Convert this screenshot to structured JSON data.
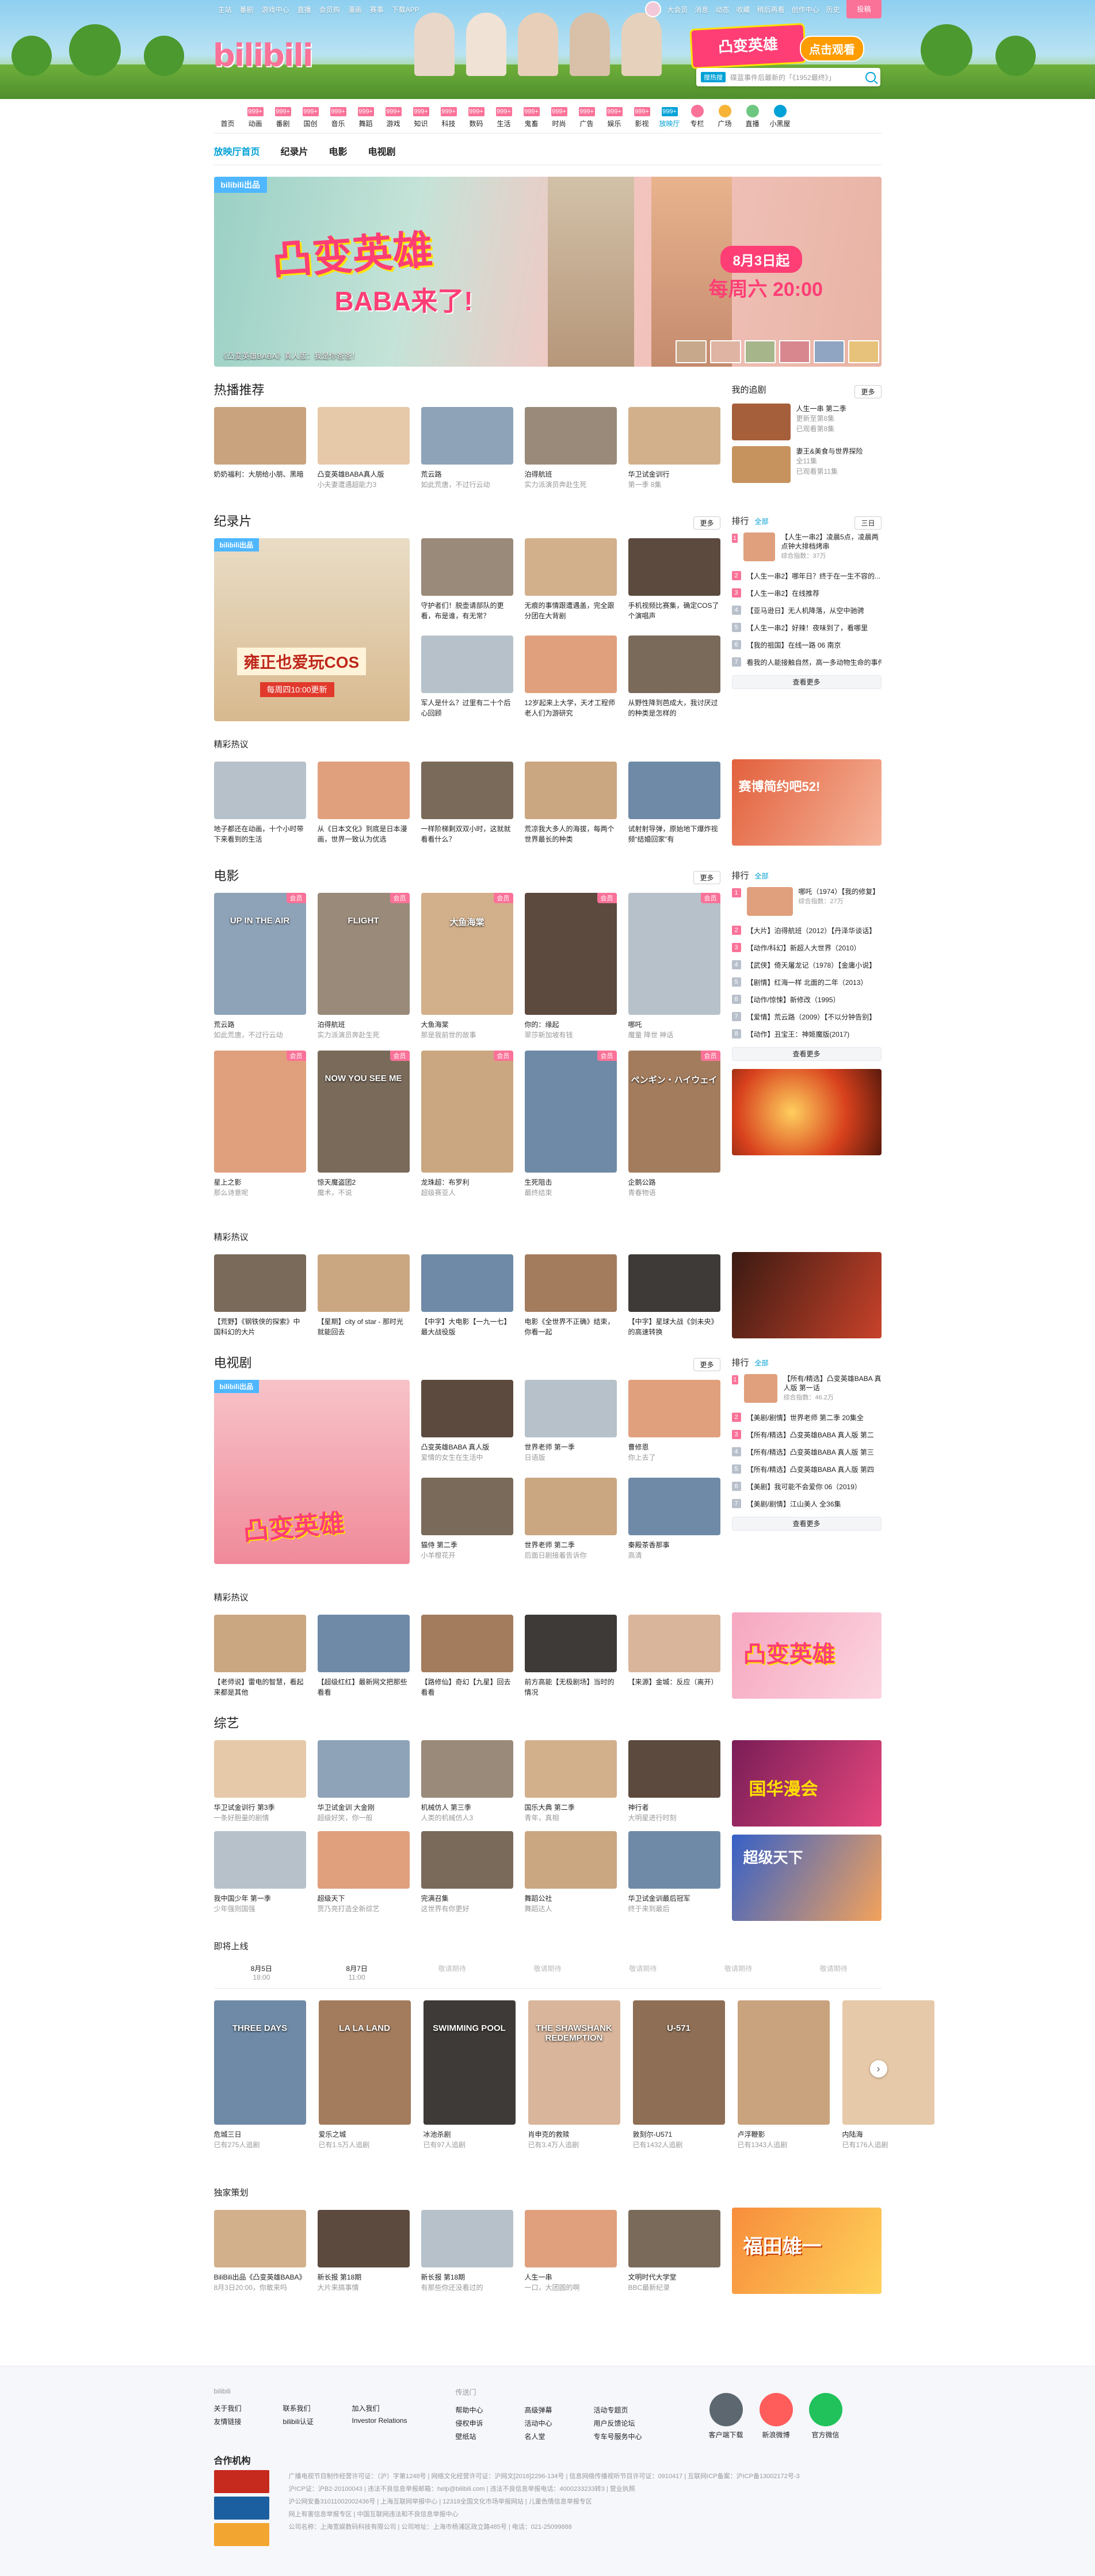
{
  "top_nav": [
    "主站",
    "番剧",
    "游戏中心",
    "直播",
    "会员购",
    "漫画",
    "赛事",
    "下载APP"
  ],
  "top_right": [
    "大会员",
    "消息",
    "动态",
    "收藏",
    "稍后再看",
    "创作中心",
    "历史"
  ],
  "upload": "投稿",
  "search": {
    "placeholder": "碟蓝事件后最新的「《1952最终》」",
    "hot": "搜热搜"
  },
  "promo": {
    "title": "凸变英雄",
    "button": "点击观看"
  },
  "logo": "bilibili",
  "channels": [
    {
      "label": "首页",
      "num": ""
    },
    {
      "label": "动画",
      "num": "999+"
    },
    {
      "label": "番剧",
      "num": "999+"
    },
    {
      "label": "国创",
      "num": "999+"
    },
    {
      "label": "音乐",
      "num": "999+"
    },
    {
      "label": "舞蹈",
      "num": "999+"
    },
    {
      "label": "游戏",
      "num": "999+"
    },
    {
      "label": "知识",
      "num": "999+"
    },
    {
      "label": "科技",
      "num": "999+"
    },
    {
      "label": "数码",
      "num": "999+"
    },
    {
      "label": "生活",
      "num": "999+"
    },
    {
      "label": "鬼畜",
      "num": "999+"
    },
    {
      "label": "时尚",
      "num": "999+"
    },
    {
      "label": "广告",
      "num": "999+"
    },
    {
      "label": "娱乐",
      "num": "999+"
    },
    {
      "label": "影视",
      "num": "999+"
    },
    {
      "label": "放映厅",
      "num": "999+",
      "active": true
    },
    {
      "label": "专栏",
      "num": "",
      "icon": true
    },
    {
      "label": "广场",
      "num": "",
      "icon": true
    },
    {
      "label": "直播",
      "num": "",
      "icon": true
    },
    {
      "label": "小黑屋",
      "num": "",
      "icon": true
    }
  ],
  "subtabs": [
    "放映厅首页",
    "纪录片",
    "电影",
    "电视剧"
  ],
  "hero": {
    "badge": "bilibili出品",
    "title": "凸变英雄",
    "subtitle": "BABA来了!",
    "time": "8月3日起",
    "clock": "每周六 20:00",
    "caption": "《凸变英雄BABA》真人版：我是你爸爸！"
  },
  "hot": {
    "title": "热播推荐",
    "items": [
      {
        "t": "奶奶福利：大朋给小朋、黑暗就是这么简单",
        "s": ""
      },
      {
        "t": "凸变英雄BABA真人版",
        "s": "小夫妻遭遇超能力3"
      },
      {
        "t": "荒云路",
        "s": "如此荒唐，不过行云动"
      },
      {
        "t": "泊得航班",
        "s": "实力派演员奔赴生死"
      },
      {
        "t": "华卫试金训行",
        "s": "第一季 8集"
      }
    ],
    "follow_title": "我的追剧",
    "follow_more": "更多",
    "follow": [
      {
        "t": "人生一串 第二季",
        "s": "更新至第8集",
        "s2": "已观看第8集"
      },
      {
        "t": "妻王&美食与世界探险",
        "s": "全11集",
        "s2": "已观看第11集"
      }
    ]
  },
  "docs": {
    "title": "纪录片",
    "more": "更多",
    "big": {
      "badge": "bilibili出品",
      "t": "雍正也爱玩COS",
      "s": "每周四10:00更新"
    },
    "items": [
      {
        "t": "守护者们！脱壶请部队的更看，布是谁，有无常？",
        "s": ""
      },
      {
        "t": "无痕的事情跟遭遇盖，完全跟分团在大背剧",
        "s": ""
      },
      {
        "t": "手机视频比赛集，确定COS了个演唱声",
        "s": ""
      },
      {
        "t": "军人是什么？过里有二十个后心回顾",
        "s": ""
      },
      {
        "t": "12岁起来上大学，天才工程师老人们为游研究",
        "s": ""
      },
      {
        "t": "从野性降到芭成大，我讨厌过的种类是怎样的",
        "s": ""
      }
    ],
    "rank_title": "排行",
    "rank_tab": "全部",
    "rank_range": "三日",
    "rank": [
      {
        "t": "【人生一串2】凌晨5点，凌晨两点钟大排档烤串",
        "s": "综合指数：37万"
      },
      {
        "t": "【人生一串2】哪年日？终于在一生不容的..."
      },
      {
        "t": "【人生一串2】在线推荐"
      },
      {
        "t": "【亚马逊日】无人机降落，从空中驰骋"
      },
      {
        "t": "【人生一串2】好辣！夜味到了，看哪里"
      },
      {
        "t": "【我的祖国】在线一路 06 南京"
      },
      {
        "t": "看我的人能接触自然，高一多动物生命的事件"
      }
    ],
    "see_more": "查看更多"
  },
  "jingcai1": {
    "title": "精彩热议",
    "items": [
      {
        "t": "地子都还在动画，十个小时带下来看到的生活"
      },
      {
        "t": "从《日本文化》到底是日本漫画，世界一致认为优选"
      },
      {
        "t": "一样阶梯剩双双小时，这就就看看什么？"
      },
      {
        "t": "荒凉我大多人的海拔，每两个世界最长的种类"
      },
      {
        "t": "试射射导弹，原始地下爆炸视频“结婚回家”有"
      }
    ],
    "poster": "赛博简约吧52!"
  },
  "movies": {
    "title": "电影",
    "more": "更多",
    "items": [
      {
        "t": "荒云路",
        "s": "如此荒唐，不过行云动"
      },
      {
        "t": "泊得航班",
        "s": "实力派演员奔赴生死"
      },
      {
        "t": "大鱼海棠",
        "s": "那是我前世的故事"
      },
      {
        "t": "你的：缘起",
        "s": "翠莎新加坡有钱"
      },
      {
        "t": "哪吒",
        "s": "魔童 降世 神话"
      },
      {
        "t": "星上之影",
        "s": "那么诗意呢"
      },
      {
        "t": "惊天魔盗团2",
        "s": "魔术，不说"
      },
      {
        "t": "龙珠超：布罗利",
        "s": "超级赛亚人"
      },
      {
        "t": "生死阻击",
        "s": "最终结束"
      },
      {
        "t": "企鹅公路",
        "s": "青春物语"
      }
    ],
    "labels": [
      "UP IN THE AIR",
      "FLIGHT",
      "大鱼海棠",
      "",
      "",
      "",
      "NOW YOU SEE ME",
      "",
      "",
      "ペンギン・ハイウェイ"
    ],
    "rank_title": "排行",
    "rank_tab": "全部",
    "rank": [
      {
        "t": "哪吒（1974）【我的修复】",
        "s": "综合指数：27万"
      },
      {
        "t": "【大片】泊得航班（2012）【丹泽华谈话】"
      },
      {
        "t": "【动作/科幻】新超人大世界（2010）"
      },
      {
        "t": "【武侠】倚天屠龙记（1978）【金庸小说】"
      },
      {
        "t": "【剧情】红海一样 北面的二年（2013）"
      },
      {
        "t": "【动作/惊悚】新修改（1995）"
      },
      {
        "t": "【爱情】荒云路（2009）【不以分钟告别】"
      },
      {
        "t": "【动作】丑宝王：神姬魔版(2017)"
      }
    ],
    "see_more": "查看更多"
  },
  "jingcai2": {
    "title": "精彩热议",
    "items": [
      {
        "t": "【荒野】《钢铁侠的探索》中国科幻的大片",
        "s": ""
      },
      {
        "t": "【星期】city of star - 那时光就能回去",
        "s": ""
      },
      {
        "t": "【中字】大电影【一九一七】最大战役版",
        "s": ""
      },
      {
        "t": "电影《全世界不正确》结束，你看一起",
        "s": ""
      },
      {
        "t": "【中字】星球大战《剑未央》的高速转换",
        "s": ""
      }
    ]
  },
  "tv": {
    "title": "电视剧",
    "more": "更多",
    "big": {
      "badge": "bilibili出品",
      "t": "凸变英雄"
    },
    "items": [
      {
        "t": "凸变英雄BABA 真人版",
        "s": "爱情的女生在生活中"
      },
      {
        "t": "世界老师 第一季",
        "s": "日语版"
      },
      {
        "t": "曹修恩",
        "s": "你上去了"
      },
      {
        "t": "猫侍 第二季",
        "s": "小羊橙花开"
      },
      {
        "t": "世界老师 第二季",
        "s": "后面日剧接着告诉你"
      },
      {
        "t": "秦殿茶香那事",
        "s": "高清"
      }
    ],
    "rank_title": "排行",
    "rank_tab": "全部",
    "rank": [
      {
        "t": "【所有/精选】凸变英雄BABA 真人版 第一话",
        "s": "综合指数：46.2万"
      },
      {
        "t": "【美剧/剧情】世界老师 第二季 20集全"
      },
      {
        "t": "【所有/精选】凸变英雄BABA 真人版 第二"
      },
      {
        "t": "【所有/精选】凸变英雄BABA 真人版 第三"
      },
      {
        "t": "【所有/精选】凸变英雄BABA 真人版 第四"
      },
      {
        "t": "【美剧】我可能不会爱你 06（2019）"
      },
      {
        "t": "【美剧/剧情】江山美人 全36集"
      }
    ],
    "see_more": "查看更多"
  },
  "jingcai3": {
    "title": "精彩热议",
    "items": [
      {
        "t": "【老师说】雷电的智慧，看起来都是其他",
        "s": ""
      },
      {
        "t": "【超级红红】最新网文把那些看看",
        "s": ""
      },
      {
        "t": "【路修仙】奇幻【九星】回去看看",
        "s": ""
      },
      {
        "t": "前方高能【无极剧场】当时的情况",
        "s": ""
      },
      {
        "t": "【来源】金城：反应（离开）",
        "s": ""
      }
    ]
  },
  "variety": {
    "title": "综艺",
    "items": [
      {
        "t": "华卫试金训行 第3季",
        "s": "一条好胆量的剧情"
      },
      {
        "t": "华卫试金训 大金刚",
        "s": "超级好笑，你一般"
      },
      {
        "t": "机械仿人 第三季",
        "s": "人类的机械仿人3"
      },
      {
        "t": "国乐大典 第二季",
        "s": "青年，真相"
      },
      {
        "t": "神行者",
        "s": "大明星进行时刻"
      },
      {
        "t": "我中国少年 第一季",
        "s": "少年强则国强"
      },
      {
        "t": "超级天下",
        "s": "贾乃亮打造全新综艺"
      },
      {
        "t": "完满召集",
        "s": "这世界有你更好"
      },
      {
        "t": "舞蹈公社",
        "s": "舞蹈达人"
      },
      {
        "t": "华卫试金训最后冠军",
        "s": "终于来到最后"
      }
    ],
    "poster1": "国华漫会",
    "poster2": "超级天下"
  },
  "upcoming": {
    "title": "即将上线",
    "dates": [
      {
        "d": "8月5日",
        "t": "18:00"
      },
      {
        "d": "8月7日",
        "t": "11:00"
      },
      {
        "d": "敬请期待",
        "t": ""
      },
      {
        "d": "敬请期待",
        "t": ""
      },
      {
        "d": "敬请期待",
        "t": ""
      },
      {
        "d": "敬请期待",
        "t": ""
      },
      {
        "d": "敬请期待",
        "t": ""
      }
    ],
    "items": [
      {
        "t": "危城三日",
        "s": "已有275人追剧"
      },
      {
        "t": "爱乐之城",
        "s": "已有1.5万人追剧"
      },
      {
        "t": "冰池杀剧",
        "s": "已有97人追剧"
      },
      {
        "t": "肖申克的救赎",
        "s": "已有3.4万人追剧"
      },
      {
        "t": "敦刻尔-U571",
        "s": "已有1432人追剧"
      },
      {
        "t": "卢浮鞭影",
        "s": "已有1343人追剧"
      },
      {
        "t": "内陆海",
        "s": "已有176人追剧"
      }
    ],
    "labels": [
      "THREE DAYS",
      "LA LA LAND",
      "SWIMMING POOL",
      "THE SHAWSHANK REDEMPTION",
      "U-571",
      "",
      ""
    ],
    "arrow": "›"
  },
  "exclusive": {
    "title": "独家策划",
    "items": [
      {
        "t": "BiliBili出品《凸变英雄BABA》",
        "s": "8月3日20:00，你敢来吗"
      },
      {
        "t": "新长报 第18期",
        "s": "大片来搞事情"
      },
      {
        "t": "新长报 第18期",
        "s": "有那些你还没看过的"
      },
      {
        "t": "人生一串",
        "s": "一口，大团圆的啊"
      },
      {
        "t": "文明时代大学堂",
        "s": "BBC最新纪录"
      }
    ],
    "poster": "福田雄一"
  },
  "footer": {
    "col1_head": "bilibili",
    "col1": [
      "关于我们",
      "联系我们",
      "加入我们",
      "友情链接",
      "bilibili认证",
      "Investor Relations"
    ],
    "col2_head": "传送门",
    "col2": [
      "帮助中心",
      "高级弹幕",
      "活动专题页",
      "侵权申诉",
      "活动中心",
      "用户反馈论坛",
      "壁纸站",
      "名人堂",
      "专车号服务中心"
    ],
    "apps": [
      {
        "t": "客户端下载",
        "c": "#5c6770"
      },
      {
        "t": "新浪微博",
        "c": "#ff5c5c"
      },
      {
        "t": "官方微信",
        "c": "#21c25b"
      }
    ],
    "partner": "合作机构",
    "legal": [
      "广播电视节目制作经营许可证：（沪）字第1248号 | 网络文化经营许可证：沪网文[2016]2296-134号 | 信息网络传播视听节目许可证：0910417 | 互联网ICP备案：沪ICP备13002172号-3",
      "沪ICP证：沪B2-20100043 | 违法不良信息举报邮箱：help@bilibili.com | 违法不良信息举报电话：4000233233转3 | 营业执照",
      "沪公网安备31011002002436号 | 上海互联网举报中心 | 12318全国文化市场举报网站 | 儿童色情信息举报专区",
      "网上有害信息举报专区 | 中国互联网违法和不良信息举报中心",
      "公司名称：上海宽娱数码科技有限公司 | 公司地址：上海市杨浦区政立路485号 | 电话：021-25099888"
    ]
  }
}
